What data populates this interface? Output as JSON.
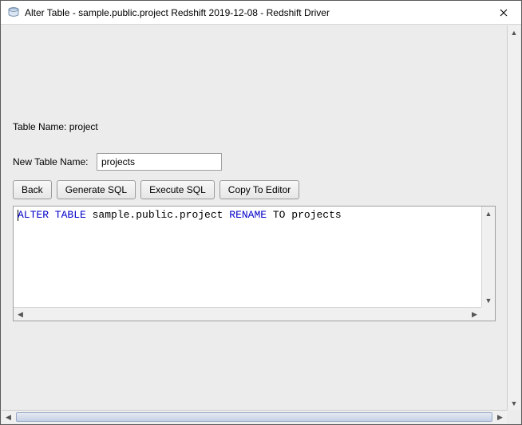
{
  "window": {
    "title": "Alter Table - sample.public.project Redshift 2019-12-08 - Redshift Driver"
  },
  "form": {
    "table_name_label": "Table Name:",
    "table_name_value": "project",
    "new_name_label": "New Table Name:",
    "new_name_value": "projects"
  },
  "buttons": {
    "back": "Back",
    "generate_sql": "Generate SQL",
    "execute_sql": "Execute SQL",
    "copy_to_editor": "Copy To Editor"
  },
  "sql": {
    "kw_alter_table": "ALTER TABLE",
    "ident1": " sample.public.project ",
    "kw_rename": "RENAME",
    "mid": " TO ",
    "ident2": "projects"
  }
}
